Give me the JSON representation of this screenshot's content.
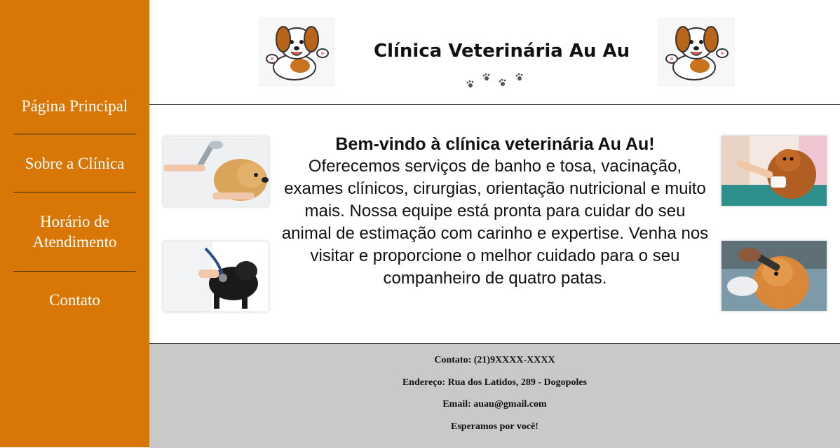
{
  "nav": {
    "items": [
      {
        "label": "Página Principal"
      },
      {
        "label": "Sobre a Clínica"
      },
      {
        "label": "Horário de Atendimento"
      },
      {
        "label": "Contato"
      }
    ]
  },
  "header": {
    "title": "Clínica Veterinária Au Au",
    "logo_icon": "cartoon-dog-icon",
    "paw_icon": "paw-prints-icon"
  },
  "main": {
    "headline": "Bem-vindo à clínica veterinária Au Au!",
    "body": "Oferecemos serviços de banho e tosa, vacinação, exames clínicos, cirurgias, orientação nutricional e muito mais. Nossa equipe está pronta para cuidar do seu animal de estimação com carinho e expertise. Venha nos visitar e proporcione o melhor cuidado para o seu companheiro de quatro patas."
  },
  "footer": {
    "contact": "Contato: (21)9XXXX-XXXX",
    "address": "Endereço: Rua dos Latidos, 289 - Dogopoles",
    "email": "Email: auau@gmail.com",
    "closing": "Esperamos por você!"
  },
  "colors": {
    "sidebar": "#d97706",
    "footer": "#c9c9c9",
    "text": "#111111"
  }
}
